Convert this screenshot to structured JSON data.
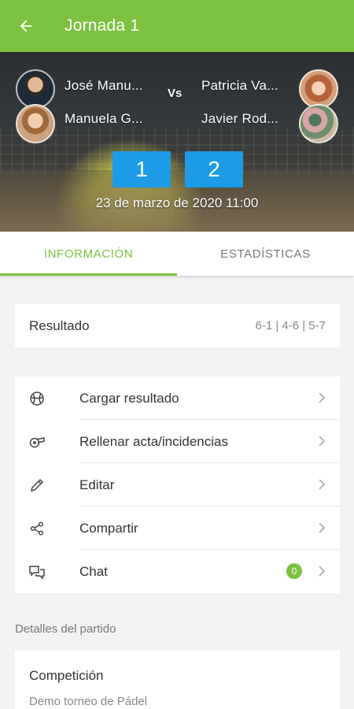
{
  "header": {
    "title": "Jornada 1",
    "back_icon": "arrow-left-icon"
  },
  "match": {
    "team1": {
      "players": [
        "José Manu...",
        "Manuela G..."
      ]
    },
    "team2": {
      "players": [
        "Patricia Va...",
        "Javier Rod..."
      ]
    },
    "vs_label": "Vs",
    "score": [
      "1",
      "2"
    ],
    "datetime": "23 de marzo de 2020 11:00"
  },
  "tabs": [
    {
      "label": "INFORMACIÓN",
      "active": true
    },
    {
      "label": "ESTADÍSTICAS",
      "active": false
    }
  ],
  "result": {
    "label": "Resultado",
    "value": "6-1 | 4-6 | 5-7"
  },
  "actions": [
    {
      "label": "Cargar resultado",
      "icon": "ball-icon"
    },
    {
      "label": "Rellenar acta/incidencias",
      "icon": "whistle-icon"
    },
    {
      "label": "Editar",
      "icon": "pencil-icon"
    },
    {
      "label": "Compartir",
      "icon": "share-icon"
    },
    {
      "label": "Chat",
      "icon": "chat-icon",
      "badge": "0"
    }
  ],
  "details": {
    "section_title": "Detalles del partido",
    "competition_label": "Competición",
    "competition_value": "Demo torneo de Pádel"
  },
  "colors": {
    "primary": "#7cc13f",
    "score_box": "#1e9be6",
    "background": "#f2f2f2"
  }
}
